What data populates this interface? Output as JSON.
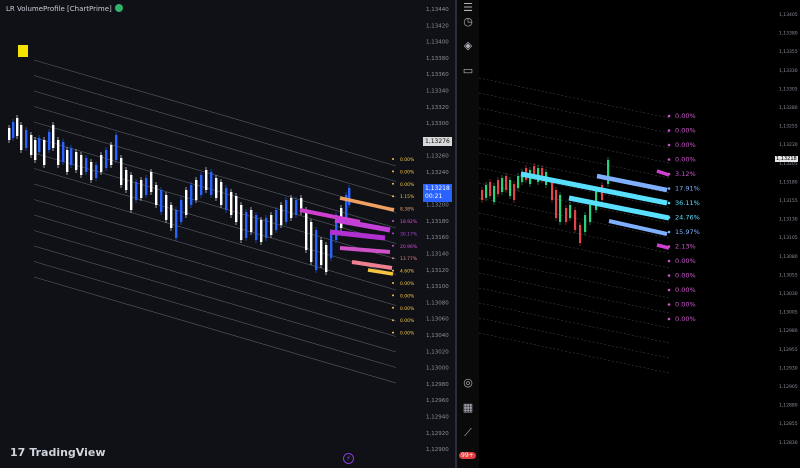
{
  "left_panel": {
    "indicator_title": "LR VolumeProfile [ChartPrime]",
    "eye_icon": "eye-icon",
    "price_axis": [
      "1,13440",
      "1,13420",
      "1,13400",
      "1,13380",
      "1,13360",
      "1,13340",
      "1,13320",
      "1,13300",
      "1,13280",
      "1,13260",
      "1,13240",
      "1,13220",
      "1,13200",
      "1,13180",
      "1,13160",
      "1,13140",
      "1,13120",
      "1,13100",
      "1,13080",
      "1,13060",
      "1,13040",
      "1,13020",
      "1,13000",
      "1,12980",
      "1,12960",
      "1,12940",
      "1,12920",
      "1,12900"
    ],
    "current_price_tag": "1,13276",
    "last_price_tag": "1,13218",
    "countdown": "00:21",
    "profile_labels": [
      {
        "text": "0.00%",
        "color": "#f5c542"
      },
      {
        "text": "0.00%",
        "color": "#f5c542"
      },
      {
        "text": "0.00%",
        "color": "#f5c542"
      },
      {
        "text": "1.15%",
        "color": "#f5c542"
      },
      {
        "text": "8.38%",
        "color": "#e8a070"
      },
      {
        "text": "18.92%",
        "color": "#d650d6"
      },
      {
        "text": "30.17%",
        "color": "#b040e0"
      },
      {
        "text": "20.96%",
        "color": "#d650d6"
      },
      {
        "text": "13.77%",
        "color": "#e88080"
      },
      {
        "text": "4.60%",
        "color": "#f5c542"
      },
      {
        "text": "0.00%",
        "color": "#f5c542"
      },
      {
        "text": "0.00%",
        "color": "#f5c542"
      },
      {
        "text": "0.00%",
        "color": "#f5c542"
      },
      {
        "text": "0.00%",
        "color": "#f5c542"
      },
      {
        "text": "0.00%",
        "color": "#f5c542"
      }
    ],
    "logo_text": "TradingView"
  },
  "toolbar": {
    "icons": [
      "menu-icon",
      "clock-icon",
      "layers-icon",
      "chat-icon",
      "target-icon",
      "calendar-icon",
      "trendline-icon",
      "notifications-icon"
    ],
    "badge": "99+"
  },
  "right_panel": {
    "price_axis": [
      "1,13405",
      "1,13380",
      "1,13355",
      "1,13330",
      "1,13305",
      "1,13280",
      "1,13255",
      "1,13230",
      "1,13205",
      "1,13180",
      "1,13155",
      "1,13130",
      "1,13105",
      "1,13080",
      "1,13055",
      "1,13030",
      "1,13005",
      "1,12980",
      "1,12955",
      "1,12930",
      "1,12905",
      "1,12880",
      "1,12855",
      "1,12830"
    ],
    "current_price_tag": "1,13218",
    "profile_labels": [
      {
        "text": "0.00%",
        "color": "#cc55cc"
      },
      {
        "text": "0.00%",
        "color": "#cc55cc"
      },
      {
        "text": "0.00%",
        "color": "#cc55cc"
      },
      {
        "text": "0.00%",
        "color": "#cc55cc"
      },
      {
        "text": "3.12%",
        "color": "#cc55cc"
      },
      {
        "text": "17.91%",
        "color": "#7fb0ff"
      },
      {
        "text": "36.11%",
        "color": "#59e0ff"
      },
      {
        "text": "24.76%",
        "color": "#59e0ff"
      },
      {
        "text": "15.97%",
        "color": "#7fb0ff"
      },
      {
        "text": "2.13%",
        "color": "#cc55cc"
      },
      {
        "text": "0.00%",
        "color": "#cc55cc"
      },
      {
        "text": "0.00%",
        "color": "#cc55cc"
      },
      {
        "text": "0.00%",
        "color": "#cc55cc"
      },
      {
        "text": "0.00%",
        "color": "#cc55cc"
      },
      {
        "text": "0.00%",
        "color": "#cc55cc"
      }
    ]
  }
}
